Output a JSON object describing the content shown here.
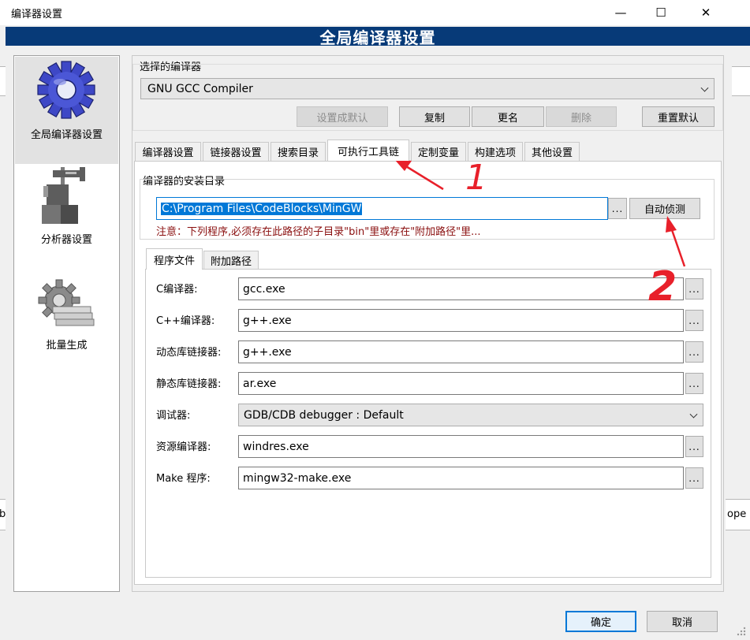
{
  "window": {
    "title": "编译器设置",
    "minimize_glyph": "—",
    "maximize_glyph": "☐",
    "close_glyph": "✕"
  },
  "header": {
    "title": "全局编译器设置"
  },
  "background": {
    "left_glyph": "b",
    "right_glyph": "ope"
  },
  "categories": [
    {
      "label": "全局编译器设置",
      "icon": "gear-icon",
      "selected": true
    },
    {
      "label": "分析器设置",
      "icon": "caliper-icon",
      "selected": false
    },
    {
      "label": "批量生成",
      "icon": "batch-gear-icon",
      "selected": false
    }
  ],
  "compiler_select": {
    "label": "选择的编译器",
    "value": "GNU GCC Compiler",
    "buttons": {
      "set_default": "设置成默认",
      "copy": "复制",
      "rename": "更名",
      "delete": "删除",
      "reset": "重置默认"
    }
  },
  "tabs": [
    {
      "label": "编译器设置"
    },
    {
      "label": "链接器设置"
    },
    {
      "label": "搜索目录"
    },
    {
      "label": "可执行工具链",
      "active": true
    },
    {
      "label": "定制变量"
    },
    {
      "label": "构建选项"
    },
    {
      "label": "其他设置"
    }
  ],
  "install_dir": {
    "label": "编译器的安装目录",
    "value": "C:\\Program Files\\CodeBlocks\\MinGW",
    "browse": "...",
    "auto_detect": "自动侦测",
    "note": "注意：下列程序,必须存在此路径的子目录\"bin\"里或存在\"附加路径\"里..."
  },
  "subtabs": [
    {
      "label": "程序文件",
      "active": true
    },
    {
      "label": "附加路径"
    }
  ],
  "programs": {
    "c_compiler": {
      "label": "C编译器:",
      "value": "gcc.exe"
    },
    "cpp_compiler": {
      "label": "C++编译器:",
      "value": "g++.exe"
    },
    "dyn_linker": {
      "label": "动态库链接器:",
      "value": "g++.exe"
    },
    "static_linker": {
      "label": "静态库链接器:",
      "value": "ar.exe"
    },
    "debugger": {
      "label": "调试器:",
      "value": "GDB/CDB debugger : Default"
    },
    "res_compiler": {
      "label": "资源编译器:",
      "value": "windres.exe"
    },
    "make": {
      "label": "Make 程序:",
      "value": "mingw32-make.exe"
    },
    "browse": "..."
  },
  "annotations": {
    "one": "1",
    "two": "2",
    "color": "#e8202a"
  },
  "footer": {
    "ok": "确定",
    "cancel": "取消"
  }
}
